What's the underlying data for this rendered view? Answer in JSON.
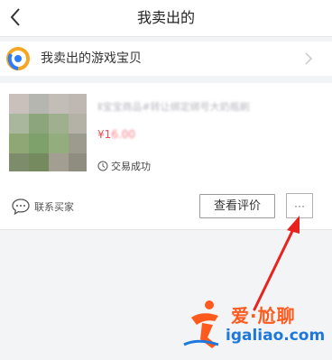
{
  "header": {
    "title": "我卖出的"
  },
  "shop": {
    "label": "我卖出的游戏宝贝"
  },
  "order": {
    "title_blurred": "Ⅱ宝宝商品#转让绑定绑号大奶瓶刷",
    "price_symbol": "¥1",
    "price_blurred": "6.00",
    "status": "交易成功",
    "contact_label": "联系买家",
    "review_label": "查看评价",
    "more_label": "···"
  },
  "watermark": {
    "name": "爱·尬聊",
    "domain": "igaliao.com"
  },
  "colors": {
    "price": "#f04a5a",
    "annotation_arrow": "#e8231f",
    "watermark_orange": "#ff5a1e",
    "watermark_blue": "#1e78dc"
  }
}
